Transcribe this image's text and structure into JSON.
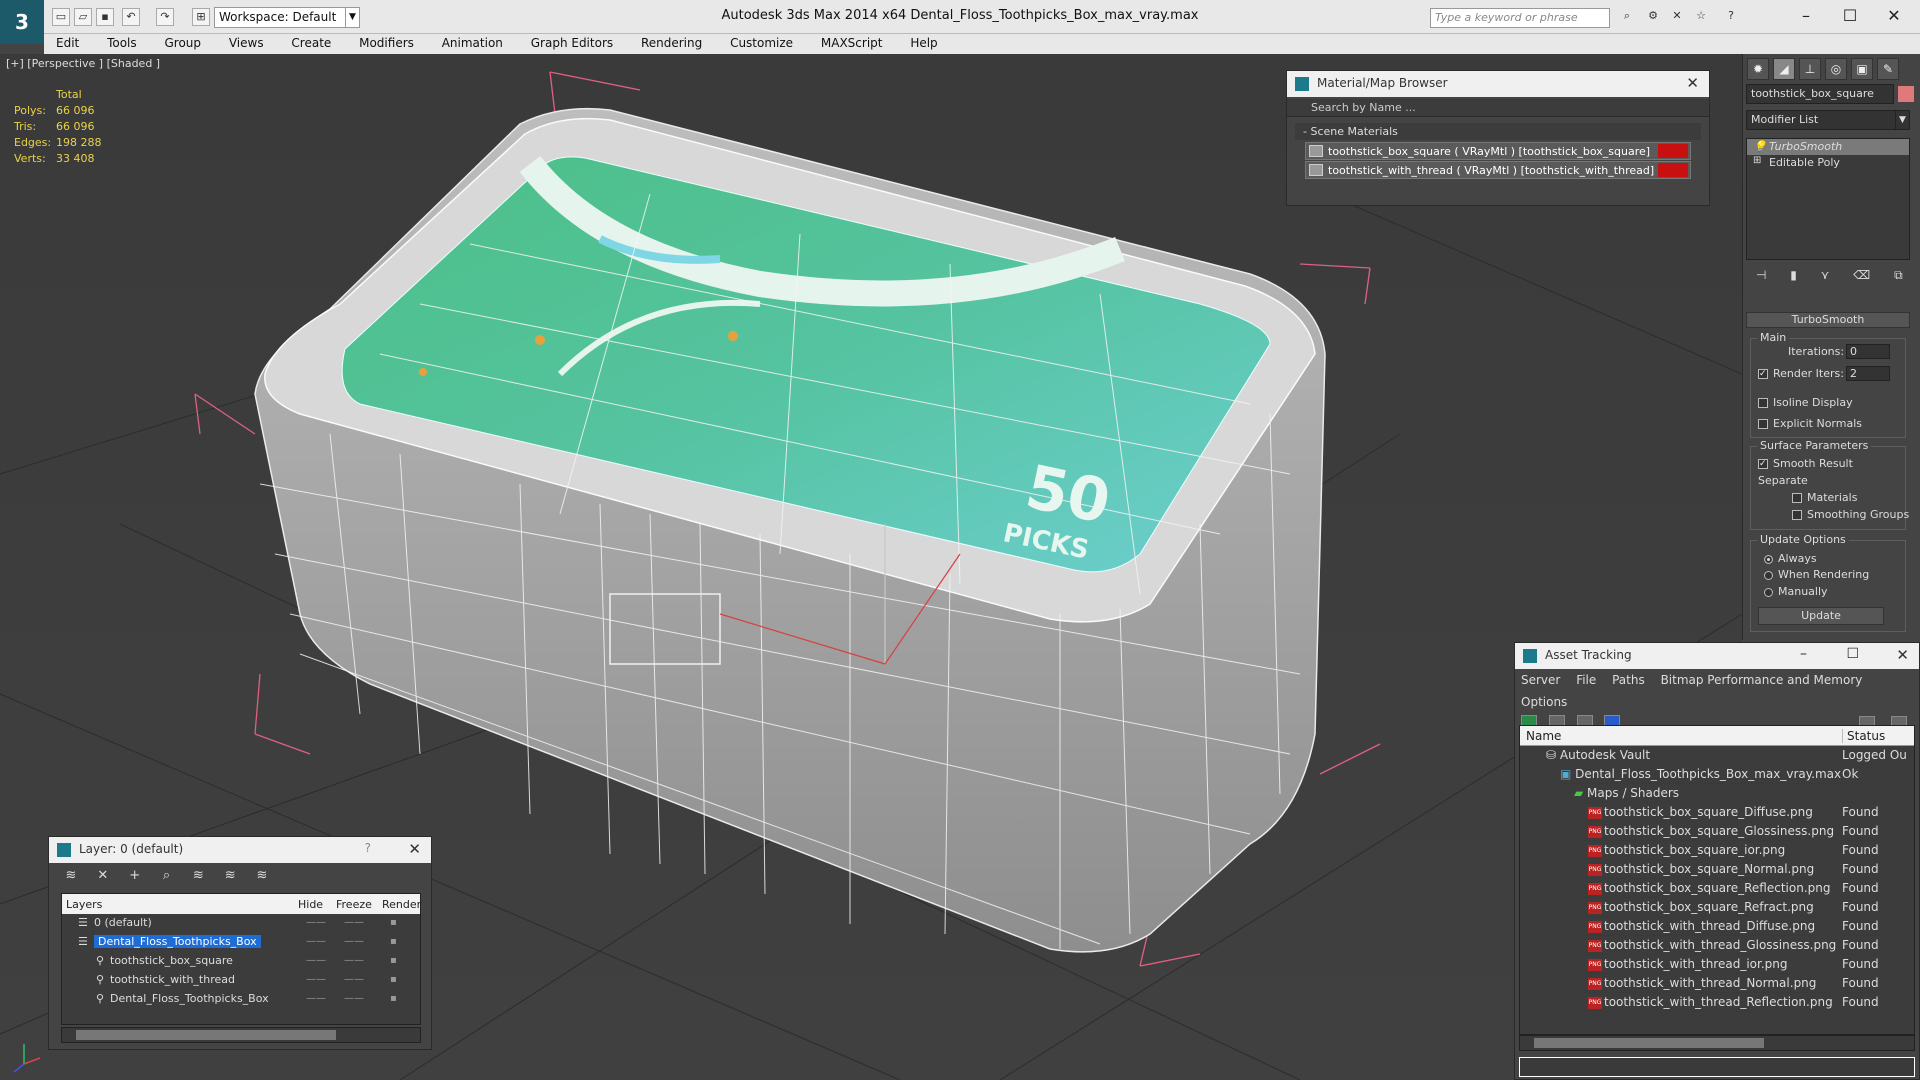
{
  "app": {
    "title": "Autodesk 3ds Max  2014 x64      Dental_Floss_Toothpicks_Box_max_vray.max",
    "workspace": "Workspace: Default",
    "search_placeholder": "Type a keyword or phrase",
    "logo_text": "3"
  },
  "menu": [
    "Edit",
    "Tools",
    "Group",
    "Views",
    "Create",
    "Modifiers",
    "Animation",
    "Graph Editors",
    "Rendering",
    "Customize",
    "MAXScript",
    "Help"
  ],
  "viewport": {
    "label": "[+] [Perspective ] [Shaded ]",
    "stats_header": "Total",
    "stats": [
      {
        "label": "Polys:",
        "value": "66 096"
      },
      {
        "label": "Tris:",
        "value": "66 096"
      },
      {
        "label": "Edges:",
        "value": "198 288"
      },
      {
        "label": "Verts:",
        "value": "33 408"
      }
    ],
    "box_number": "50",
    "box_text": "PICKS"
  },
  "material_browser": {
    "title": "Material/Map Browser",
    "search": "Search by Name ...",
    "section": "- Scene Materials",
    "materials": [
      "toothstick_box_square  ( VRayMtl ) [toothstick_box_square]",
      "toothstick_with_thread  ( VRayMtl ) [toothstick_with_thread]"
    ]
  },
  "command_panel": {
    "object_name": "toothstick_box_square",
    "modifier_list": "Modifier List",
    "stack": [
      "TurboSmooth",
      "Editable Poly"
    ],
    "rollout": "TurboSmooth",
    "main_group": "Main",
    "iterations_label": "Iterations:",
    "iterations_value": "0",
    "render_iters_label": "Render Iters:",
    "render_iters_value": "2",
    "isoline": "Isoline Display",
    "explicit": "Explicit Normals",
    "surface_group": "Surface Parameters",
    "smooth_result": "Smooth Result",
    "separate": "Separate",
    "materials": "Materials",
    "smoothing_groups": "Smoothing Groups",
    "update_group": "Update Options",
    "always": "Always",
    "when_rendering": "When Rendering",
    "manually": "Manually",
    "update_button": "Update"
  },
  "asset_tracking": {
    "title": "Asset Tracking",
    "menu": [
      "Server",
      "File",
      "Paths",
      "Bitmap Performance and Memory",
      "Options"
    ],
    "col_name": "Name",
    "col_status": "Status",
    "rows": [
      {
        "name": "Autodesk Vault",
        "status": "Logged Ou",
        "indent": 0,
        "type": "vault"
      },
      {
        "name": "Dental_Floss_Toothpicks_Box_max_vray.max",
        "status": "Ok",
        "indent": 1,
        "type": "max"
      },
      {
        "name": "Maps / Shaders",
        "status": "",
        "indent": 2,
        "type": "maps"
      },
      {
        "name": "toothstick_box_square_Diffuse.png",
        "status": "Found",
        "indent": 3,
        "type": "png"
      },
      {
        "name": "toothstick_box_square_Glossiness.png",
        "status": "Found",
        "indent": 3,
        "type": "png"
      },
      {
        "name": "toothstick_box_square_ior.png",
        "status": "Found",
        "indent": 3,
        "type": "png"
      },
      {
        "name": "toothstick_box_square_Normal.png",
        "status": "Found",
        "indent": 3,
        "type": "png"
      },
      {
        "name": "toothstick_box_square_Reflection.png",
        "status": "Found",
        "indent": 3,
        "type": "png"
      },
      {
        "name": "toothstick_box_square_Refract.png",
        "status": "Found",
        "indent": 3,
        "type": "png"
      },
      {
        "name": "toothstick_with_thread_Diffuse.png",
        "status": "Found",
        "indent": 3,
        "type": "png"
      },
      {
        "name": "toothstick_with_thread_Glossiness.png",
        "status": "Found",
        "indent": 3,
        "type": "png"
      },
      {
        "name": "toothstick_with_thread_ior.png",
        "status": "Found",
        "indent": 3,
        "type": "png"
      },
      {
        "name": "toothstick_with_thread_Normal.png",
        "status": "Found",
        "indent": 3,
        "type": "png"
      },
      {
        "name": "toothstick_with_thread_Reflection.png",
        "status": "Found",
        "indent": 3,
        "type": "png"
      }
    ]
  },
  "layer_manager": {
    "title": "Layer: 0 (default)",
    "help": "?",
    "col_layers": "Layers",
    "col_hide": "Hide",
    "col_freeze": "Freeze",
    "col_render": "Render",
    "rows": [
      {
        "name": "0 (default)",
        "indent": 0,
        "selected": false
      },
      {
        "name": "Dental_Floss_Toothpicks_Box",
        "indent": 0,
        "selected": true
      },
      {
        "name": "toothstick_box_square",
        "indent": 1,
        "selected": false
      },
      {
        "name": "toothstick_with_thread",
        "indent": 1,
        "selected": false
      },
      {
        "name": "Dental_Floss_Toothpicks_Box",
        "indent": 1,
        "selected": false
      }
    ]
  },
  "colors": {
    "selection_blue": "#1e6cd6",
    "material_red": "#c81010",
    "stats_yellow": "#e8d24a",
    "box_green": "#4fbf8a"
  }
}
